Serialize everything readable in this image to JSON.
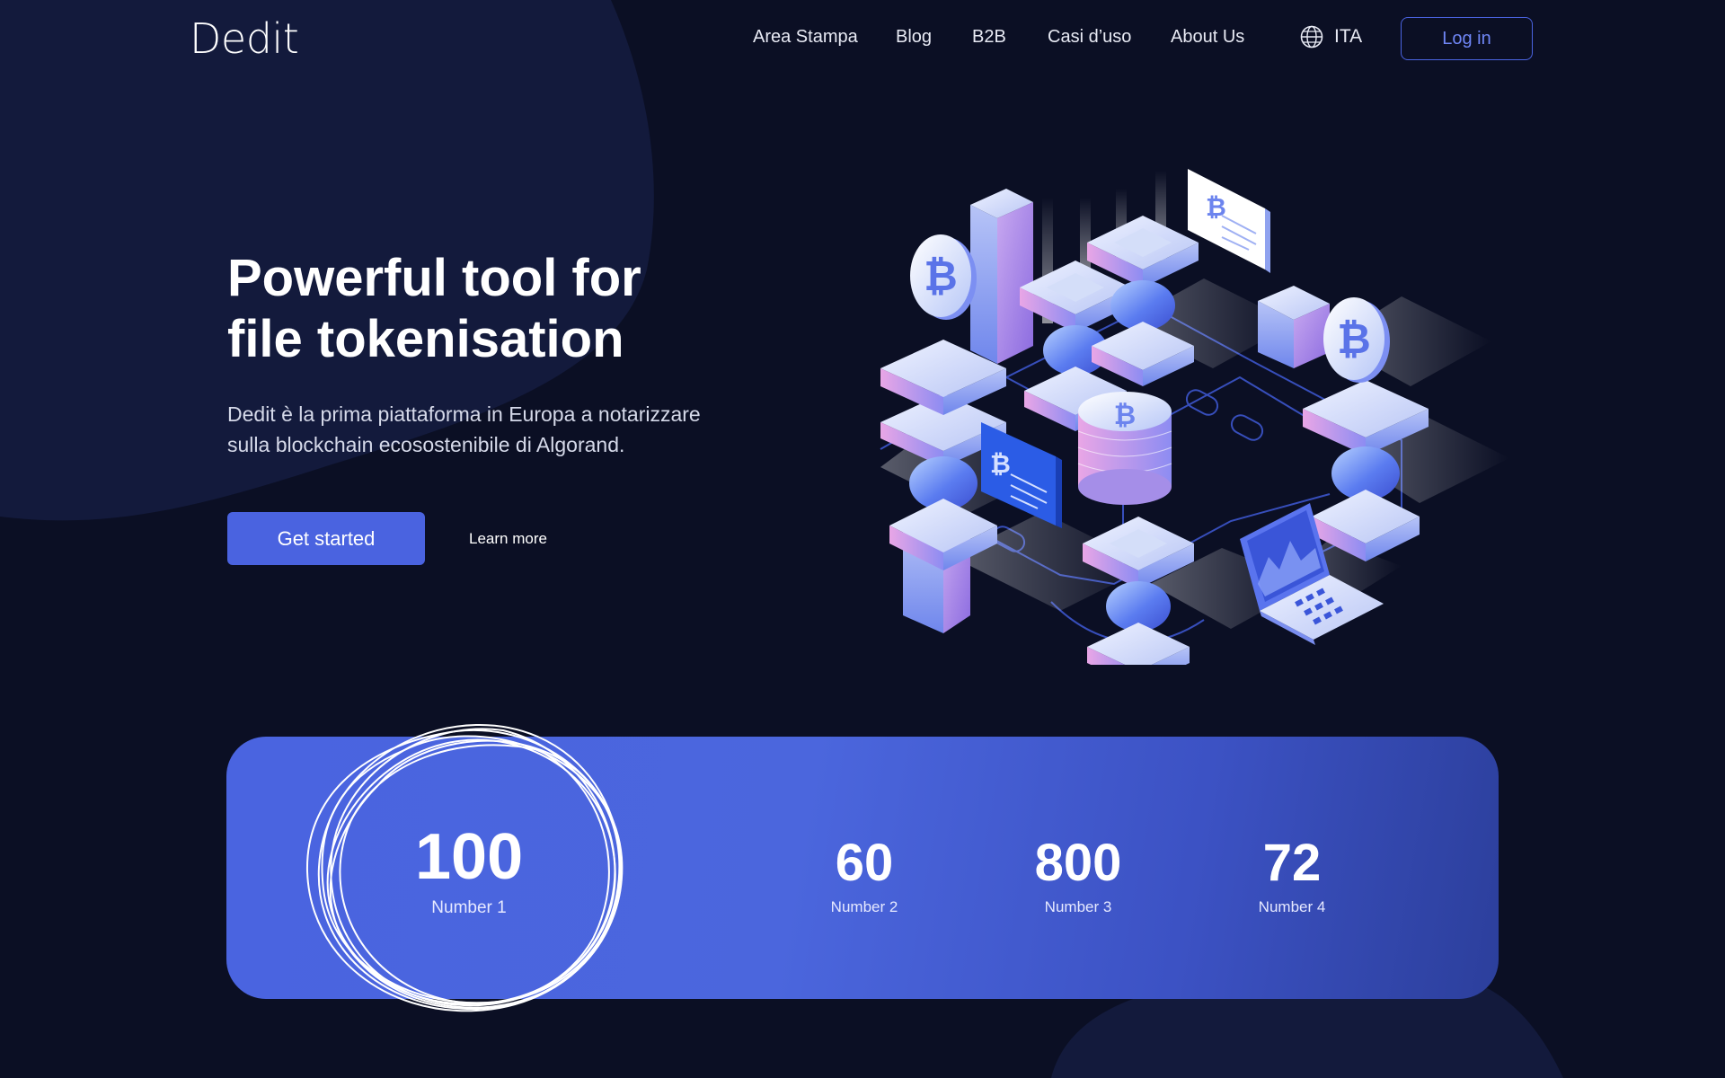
{
  "brand": {
    "logo_text": "Dedit"
  },
  "nav": {
    "links": [
      "Area Stampa",
      "Blog",
      "B2B",
      "Casi d’uso",
      "About Us"
    ],
    "language": "ITA",
    "login_label": "Log in"
  },
  "hero": {
    "title_line1": "Powerful tool for",
    "title_line2": "file tokenisation",
    "subtitle_line1": "Dedit è la prima piattaforma in Europa a notarizzare",
    "subtitle_line2": "sulla blockchain ecosostenibile di Algorand.",
    "cta_primary": "Get started",
    "cta_secondary": "Learn more"
  },
  "stats": [
    {
      "value": "100",
      "label": "Number 1"
    },
    {
      "value": "60",
      "label": "Number 2"
    },
    {
      "value": "800",
      "label": "Number 3"
    },
    {
      "value": "72",
      "label": "Number 4"
    }
  ],
  "colors": {
    "background": "#0b0f24",
    "accent": "#4a63e0",
    "text_muted": "#d5d9e9"
  },
  "icons": [
    "globe-icon",
    "bitcoin-icon",
    "laptop-icon"
  ]
}
